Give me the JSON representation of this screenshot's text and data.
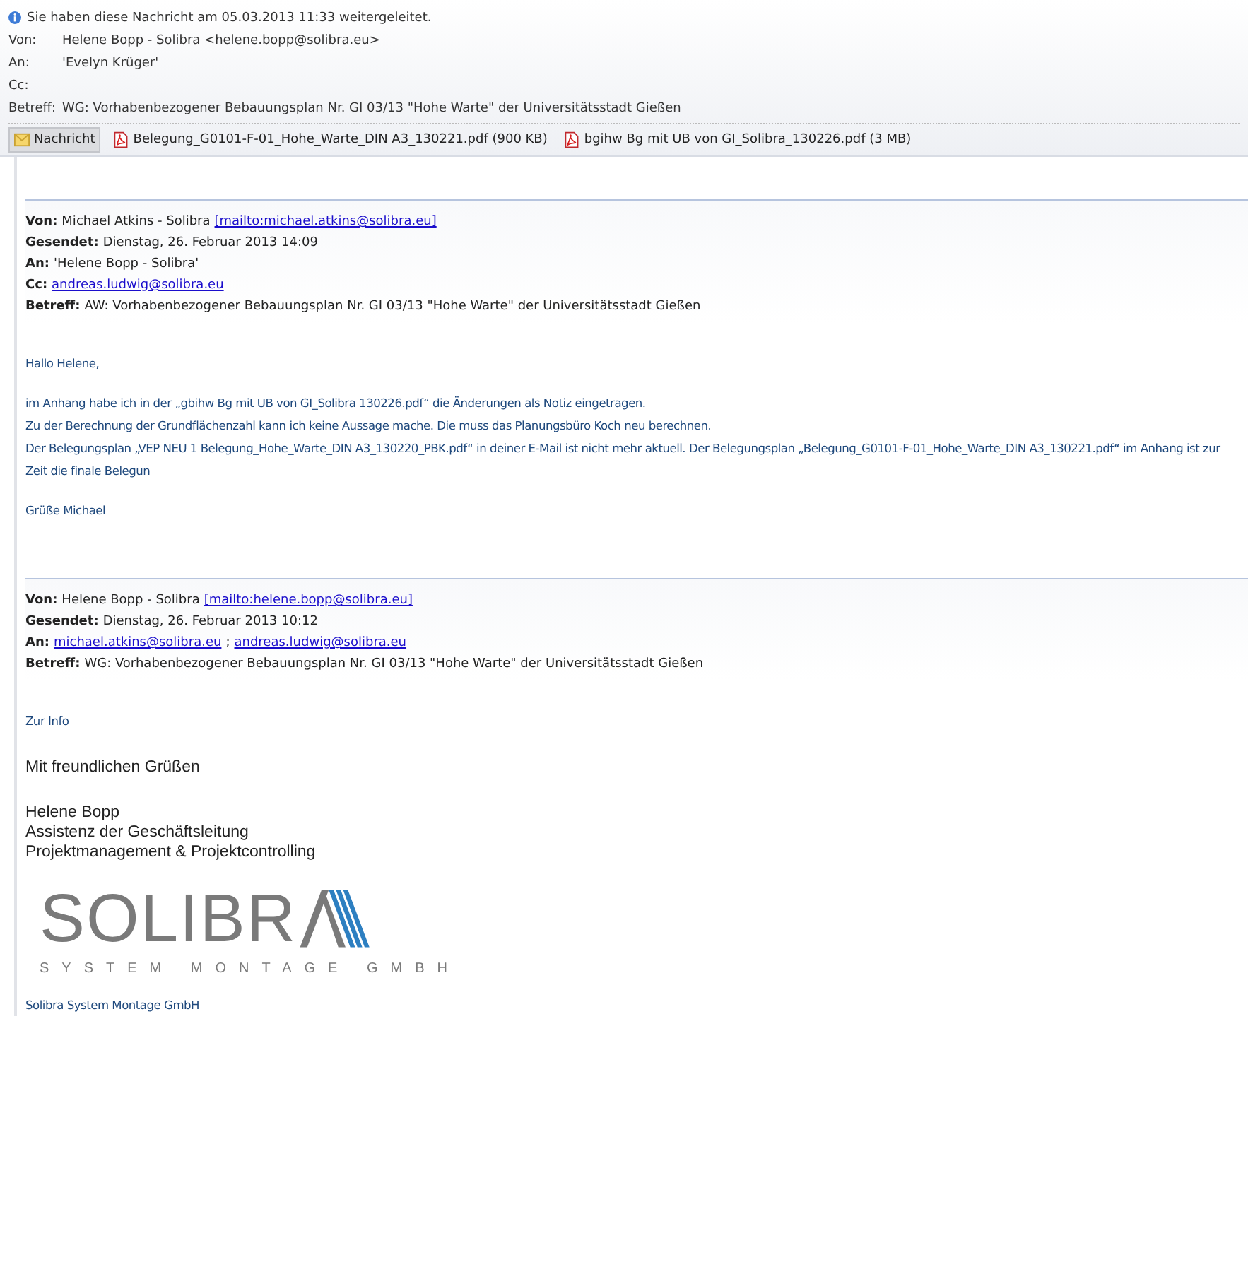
{
  "notice": "Sie haben diese Nachricht am 05.03.2013 11:33 weitergeleitet.",
  "header_fields": [
    {
      "label": "Von:",
      "value": "Helene Bopp - Solibra <helene.bopp@solibra.eu>"
    },
    {
      "label": "An:",
      "value": "'Evelyn Krüger'"
    },
    {
      "label": "Cc:"
    },
    {
      "label": "Betreff:",
      "value": "WG: Vorhabenbezogener Bebauungsplan Nr. GI 03/13 \"Hohe Warte\" der Universitätsstadt Gießen"
    }
  ],
  "attachments": [
    {
      "kind": "message",
      "label": "Nachricht",
      "selected": true
    },
    {
      "kind": "pdf",
      "label": "Belegung_G0101-F-01_Hohe_Warte_DIN A3_130221.pdf (900 KB)",
      "selected": false
    },
    {
      "kind": "pdf",
      "label": "bgihw Bg mit UB von GI_Solibra_130226.pdf (3 MB)",
      "selected": false
    }
  ],
  "messages": [
    {
      "headers": [
        {
          "label": "Von:",
          "parts": [
            {
              "kind": "text",
              "text": "Michael Atkins - Solibra"
            },
            {
              "kind": "link",
              "text": "[mailto:michael.atkins@solibra.eu]"
            }
          ]
        },
        {
          "label": "Gesendet:",
          "parts": [
            {
              "kind": "text",
              "text": "Dienstag, 26. Februar 2013 14:09"
            }
          ]
        },
        {
          "label": "An:",
          "parts": [
            {
              "kind": "text",
              "text": "'Helene Bopp - Solibra'"
            }
          ]
        },
        {
          "label": "Cc:",
          "parts": [
            {
              "kind": "link",
              "text": "andreas.ludwig@solibra.eu"
            }
          ]
        },
        {
          "label": "Betreff:",
          "parts": [
            {
              "kind": "text",
              "text": "AW: Vorhabenbezogener Bebauungsplan Nr. GI 03/13 \"Hohe Warte\" der Universitätsstadt Gießen"
            }
          ]
        }
      ],
      "body": [
        {
          "kind": "blue",
          "lines": [
            "Hallo Helene,"
          ]
        },
        {
          "kind": "blue",
          "lines": [
            "im Anhang habe ich in der „gbihw Bg mit UB von GI_Solibra 130226.pdf“ die Änderungen als Notiz eingetragen.",
            "Zu der Berechnung der Grundflächenzahl kann ich keine Aussage mache. Die muss das Planungsbüro Koch neu berechnen.",
            "Der Belegungsplan „VEP NEU 1 Belegung_Hohe_Warte_DIN A3_130220_PBK.pdf“ in deiner E-Mail ist nicht mehr aktuell. Der Belegungsplan „Belegung_G0101-F-01_Hohe_Warte_DIN A3_130221.pdf“ im Anhang ist zur Zeit die finale Belegun"
          ]
        },
        {
          "kind": "blue",
          "lines": [
            "Grüße Michael"
          ]
        }
      ]
    },
    {
      "headers": [
        {
          "label": "Von:",
          "parts": [
            {
              "kind": "text",
              "text": "Helene Bopp - Solibra"
            },
            {
              "kind": "link",
              "text": "[mailto:helene.bopp@solibra.eu]"
            }
          ]
        },
        {
          "label": "Gesendet:",
          "parts": [
            {
              "kind": "text",
              "text": "Dienstag, 26. Februar 2013 10:12"
            }
          ]
        },
        {
          "label": "An:",
          "parts": [
            {
              "kind": "link",
              "text": "michael.atkins@solibra.eu"
            },
            {
              "kind": "text",
              "text": ";"
            },
            {
              "kind": "link",
              "text": "andreas.ludwig@solibra.eu"
            }
          ]
        },
        {
          "label": "Betreff:",
          "parts": [
            {
              "kind": "text",
              "text": "WG: Vorhabenbezogener Bebauungsplan Nr. GI 03/13 \"Hohe Warte\" der Universitätsstadt Gießen"
            }
          ]
        }
      ],
      "body": [
        {
          "kind": "blue",
          "lines": [
            "Zur Info"
          ]
        },
        {
          "kind": "black",
          "lines": [
            "Mit freundlichen Grüßen"
          ]
        },
        {
          "kind": "black",
          "lines": [
            "Helene Bopp",
            "Assistenz der Geschäftsleitung",
            "Projektmanagement & Projektcontrolling"
          ]
        },
        {
          "kind": "logo",
          "lines": [
            "SOLIBR",
            "SYSTEM MONTAGE GMBH"
          ]
        },
        {
          "kind": "blue",
          "lines": [
            "Solibra System Montage GmbH"
          ]
        }
      ]
    }
  ]
}
